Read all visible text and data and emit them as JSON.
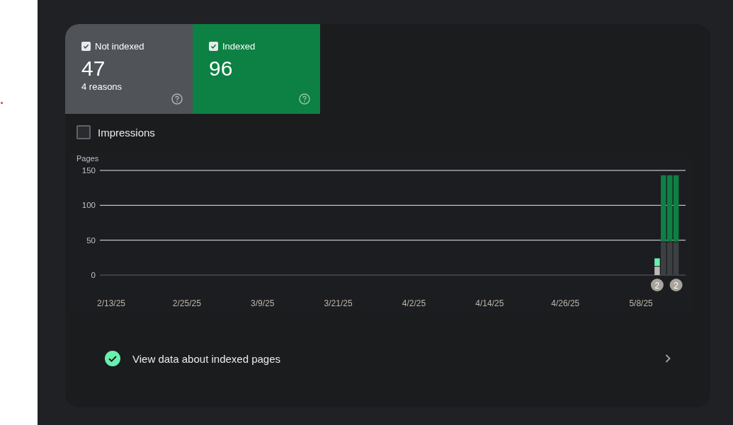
{
  "tiles": [
    {
      "label": "Not indexed",
      "checked": true,
      "count": "47",
      "subtitle": "4 reasons",
      "kind": "not_indexed"
    },
    {
      "label": "Indexed",
      "checked": true,
      "count": "96",
      "kind": "indexed"
    }
  ],
  "impressions": {
    "label": "Impressions",
    "checked": false
  },
  "chart": {
    "chart_data": {
      "type": "bar",
      "stacked": true,
      "ylabel": "Pages",
      "ylim": [
        0,
        150
      ],
      "yticks": [
        0,
        50,
        100,
        150
      ],
      "categories": [
        null,
        null,
        null,
        null,
        null,
        "2/13/25",
        null,
        null,
        null,
        null,
        null,
        null,
        null,
        null,
        null,
        null,
        null,
        "2/25/25",
        null,
        null,
        null,
        null,
        null,
        null,
        null,
        null,
        null,
        null,
        null,
        "3/9/25",
        null,
        null,
        null,
        null,
        null,
        null,
        null,
        null,
        null,
        null,
        null,
        "3/21/25",
        null,
        null,
        null,
        null,
        null,
        null,
        null,
        null,
        null,
        null,
        null,
        "4/2/25",
        null,
        null,
        null,
        null,
        null,
        null,
        null,
        null,
        null,
        null,
        null,
        "4/14/25",
        null,
        null,
        null,
        null,
        null,
        null,
        null,
        null,
        null,
        null,
        null,
        "4/26/25",
        null,
        null,
        null,
        null,
        null,
        null,
        null,
        null,
        null,
        null,
        null,
        "5/8/25",
        null,
        null,
        null,
        null,
        null,
        null
      ],
      "series": [
        {
          "color": "#bdbab4",
          "values": [
            null,
            null,
            null,
            null,
            null,
            null,
            null,
            null,
            null,
            null,
            null,
            null,
            null,
            null,
            null,
            null,
            null,
            null,
            null,
            null,
            null,
            null,
            null,
            null,
            null,
            null,
            null,
            null,
            null,
            null,
            null,
            null,
            null,
            null,
            null,
            null,
            null,
            null,
            null,
            null,
            null,
            null,
            null,
            null,
            null,
            null,
            null,
            null,
            null,
            null,
            null,
            null,
            null,
            null,
            null,
            null,
            null,
            null,
            null,
            null,
            null,
            null,
            null,
            null,
            null,
            null,
            null,
            null,
            null,
            null,
            null,
            null,
            null,
            null,
            null,
            null,
            null,
            null,
            null,
            null,
            null,
            null,
            null,
            null,
            null,
            null,
            null,
            null,
            null,
            null,
            null,
            12,
            null,
            null,
            null,
            null
          ]
        },
        {
          "color": "#69f0ae",
          "values": [
            null,
            null,
            null,
            null,
            null,
            null,
            null,
            null,
            null,
            null,
            null,
            null,
            null,
            null,
            null,
            null,
            null,
            null,
            null,
            null,
            null,
            null,
            null,
            null,
            null,
            null,
            null,
            null,
            null,
            null,
            null,
            null,
            null,
            null,
            null,
            null,
            null,
            null,
            null,
            null,
            null,
            null,
            null,
            null,
            null,
            null,
            null,
            null,
            null,
            null,
            null,
            null,
            null,
            null,
            null,
            null,
            null,
            null,
            null,
            null,
            null,
            null,
            null,
            null,
            null,
            null,
            null,
            null,
            null,
            null,
            null,
            null,
            null,
            null,
            null,
            null,
            null,
            null,
            null,
            null,
            null,
            null,
            null,
            null,
            null,
            null,
            null,
            null,
            null,
            null,
            null,
            12,
            null,
            null,
            null,
            null
          ]
        },
        {
          "color": "#3c4043",
          "values": [
            null,
            null,
            null,
            null,
            null,
            null,
            null,
            null,
            null,
            null,
            null,
            null,
            null,
            null,
            null,
            null,
            null,
            null,
            null,
            null,
            null,
            null,
            null,
            null,
            null,
            null,
            null,
            null,
            null,
            null,
            null,
            null,
            null,
            null,
            null,
            null,
            null,
            null,
            null,
            null,
            null,
            null,
            null,
            null,
            null,
            null,
            null,
            null,
            null,
            null,
            null,
            null,
            null,
            null,
            null,
            null,
            null,
            null,
            null,
            null,
            null,
            null,
            null,
            null,
            null,
            null,
            null,
            null,
            null,
            null,
            null,
            null,
            null,
            null,
            null,
            null,
            null,
            null,
            null,
            null,
            null,
            null,
            null,
            null,
            null,
            null,
            null,
            null,
            null,
            null,
            null,
            null,
            47,
            47,
            47,
            null
          ]
        },
        {
          "color": "#0d8043",
          "values": [
            null,
            null,
            null,
            null,
            null,
            null,
            null,
            null,
            null,
            null,
            null,
            null,
            null,
            null,
            null,
            null,
            null,
            null,
            null,
            null,
            null,
            null,
            null,
            null,
            null,
            null,
            null,
            null,
            null,
            null,
            null,
            null,
            null,
            null,
            null,
            null,
            null,
            null,
            null,
            null,
            null,
            null,
            null,
            null,
            null,
            null,
            null,
            null,
            null,
            null,
            null,
            null,
            null,
            null,
            null,
            null,
            null,
            null,
            null,
            null,
            null,
            null,
            null,
            null,
            null,
            null,
            null,
            null,
            null,
            null,
            null,
            null,
            null,
            null,
            null,
            null,
            null,
            null,
            null,
            null,
            null,
            null,
            null,
            null,
            null,
            null,
            null,
            null,
            null,
            null,
            null,
            null,
            96,
            96,
            96,
            null
          ]
        }
      ],
      "annotations": [
        "2",
        "2"
      ]
    }
  },
  "link": {
    "label": "View data about indexed pages"
  }
}
